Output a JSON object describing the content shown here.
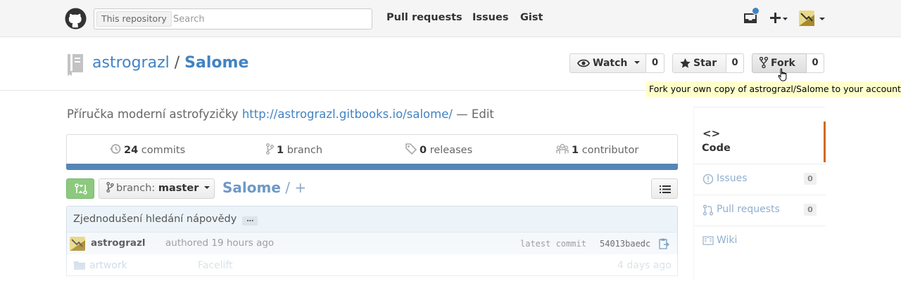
{
  "header": {
    "search_scope": "This repository",
    "search_placeholder": "Search",
    "nav": [
      "Pull requests",
      "Issues",
      "Gist"
    ],
    "icons": [
      "github-logo-icon",
      "inbox-icon",
      "plus-icon",
      "user-avatar"
    ]
  },
  "repo": {
    "owner": "astrograzl",
    "separator": "/",
    "name": "Salome",
    "watch": {
      "label": "Watch",
      "count": "0"
    },
    "star": {
      "label": "Star",
      "count": "0"
    },
    "fork": {
      "label": "Fork",
      "count": "0"
    },
    "fork_tooltip": "Fork your own copy of astrograzl/Salome to your account"
  },
  "description": {
    "text": "Příručka moderní astrofyzičky",
    "url": "http://astrograzl.gitbooks.io/salome/",
    "dash": "—",
    "edit": "Edit"
  },
  "summary": {
    "commits": {
      "count": "24",
      "label": "commits"
    },
    "branches": {
      "count": "1",
      "label": "branch"
    },
    "releases": {
      "count": "0",
      "label": "releases"
    },
    "contributors": {
      "count": "1",
      "label": "contributor"
    },
    "language_color": "#5686b5"
  },
  "file_nav": {
    "branch_prefix": "branch:",
    "branch": "master",
    "breadcrumb_repo": "Salome",
    "breadcrumb_sep": "/",
    "breadcrumb_plus": "+"
  },
  "commit": {
    "message": "Zjednodušení hledání nápovědy",
    "ellipsis": "…",
    "author": "astrograzl",
    "authored": "authored 19 hours ago",
    "latest_label": "latest commit",
    "sha": "54013baedc"
  },
  "files": [
    {
      "name": "artwork",
      "message": "Facelift",
      "age": "4 days ago"
    }
  ],
  "sidebar": {
    "code_glyph": "<>",
    "code_label": "Code",
    "accent_color": "#d26911",
    "items": [
      {
        "label": "Issues",
        "count": "0",
        "icon": "issue-icon"
      },
      {
        "label": "Pull requests",
        "count": "0",
        "icon": "pull-request-icon"
      },
      {
        "label": "Wiki",
        "icon": "wiki-icon"
      }
    ]
  }
}
